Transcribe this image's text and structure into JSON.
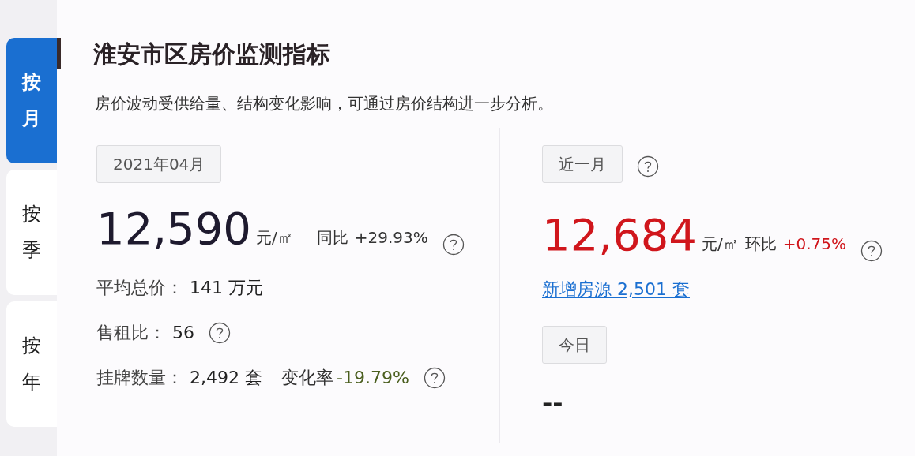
{
  "tabs": [
    {
      "label": "按月",
      "selected": true
    },
    {
      "label": "按季",
      "selected": false
    },
    {
      "label": "按年",
      "selected": false
    }
  ],
  "title": "淮安市区房价监测指标",
  "description": "房价波动受供给量、结构变化影响，可通过房价结构进一步分析。",
  "monthly": {
    "period": "2021年04月",
    "price": "12,590",
    "unit": "元/㎡",
    "change": {
      "label": "同比",
      "value": "+29.93%",
      "kind": "neutral"
    },
    "help": true,
    "stats": [
      {
        "label": "平均总价：",
        "value": "141 万元",
        "help": false
      },
      {
        "label": "售租比：",
        "value": "56",
        "help": true
      },
      {
        "label": "挂牌数量：",
        "value": "2,492 套",
        "change": {
          "label": "变化率",
          "value": "-19.79%",
          "kind": "negative"
        },
        "help": true
      }
    ]
  },
  "recent": {
    "period": "近一月",
    "period_help": true,
    "price": "12,684",
    "unit": "元/㎡",
    "change": {
      "label": "环比",
      "value": "+0.75%",
      "kind": "positive"
    },
    "help": true,
    "link": "新增房源 2,501 套"
  },
  "today": {
    "period": "今日",
    "value": "--"
  }
}
